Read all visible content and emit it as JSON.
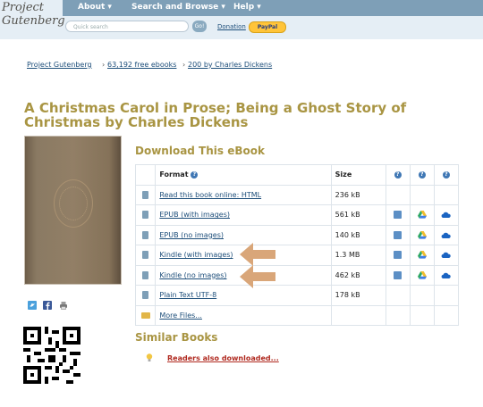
{
  "header": {
    "logo_line1": "Project",
    "logo_line2": "Gutenberg",
    "nav": [
      "About ▾",
      "Search and Browse ▾",
      "Help ▾"
    ],
    "search_placeholder": "Quick search",
    "go_label": "Go!",
    "donation_label": "Donation",
    "paypal_label": "PayPal"
  },
  "breadcrumb": [
    "Project Gutenberg",
    "63,192 free ebooks",
    "200 by Charles Dickens"
  ],
  "title": "A Christmas Carol in Prose; Being a Ghost Story of Christmas by Charles Dickens",
  "download": {
    "heading": "Download This eBook",
    "columns": [
      "Format",
      "Size"
    ],
    "rows": [
      {
        "format": "Read this book online: HTML",
        "size": "236 kB",
        "icon": "book-icon",
        "services": []
      },
      {
        "format": "EPUB (with images)",
        "size": "561 kB",
        "icon": "book-icon",
        "services": [
          "dropbox-icon",
          "google-drive-icon",
          "onedrive-icon"
        ]
      },
      {
        "format": "EPUB (no images)",
        "size": "140 kB",
        "icon": "book-icon",
        "services": [
          "dropbox-icon",
          "google-drive-icon",
          "onedrive-icon"
        ]
      },
      {
        "format": "Kindle (with images)",
        "size": "1.3 MB",
        "icon": "book-icon",
        "services": [
          "dropbox-icon",
          "google-drive-icon",
          "onedrive-icon"
        ]
      },
      {
        "format": "Kindle (no images)",
        "size": "462 kB",
        "icon": "book-icon",
        "services": [
          "dropbox-icon",
          "google-drive-icon",
          "onedrive-icon"
        ]
      },
      {
        "format": "Plain Text UTF-8",
        "size": "178 kB",
        "icon": "book-icon",
        "services": []
      },
      {
        "format": "More Files...",
        "size": "",
        "icon": "folder-icon",
        "services": []
      }
    ]
  },
  "similar": {
    "heading": "Similar Books",
    "link": "Readers also downloaded..."
  },
  "colors": {
    "accent_title": "#a99543",
    "nav_bar": "#7e9fb7",
    "link": "#1d4e7a",
    "arrow": "#d9a679",
    "readers_link": "#b02a20"
  }
}
